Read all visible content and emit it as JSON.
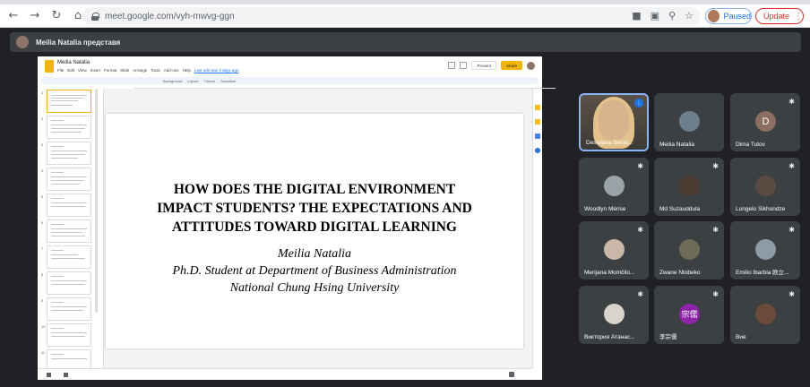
{
  "browser": {
    "url": "meet.google.com/vyh-mwvg-ggn",
    "profile_status": "Paused",
    "update_label": "Update",
    "nav_icons": [
      "back-arrow",
      "forward-arrow",
      "reload",
      "home"
    ]
  },
  "meet": {
    "presenting_label": "Meilia Natalia представя"
  },
  "slides_app": {
    "doc_title": "Meilia Natalia",
    "menus": [
      "File",
      "Edit",
      "View",
      "Insert",
      "Format",
      "Slide",
      "Arrange",
      "Tools",
      "Add-ons",
      "Help",
      "Last edit was 2 days ago"
    ],
    "present_label": "Present",
    "share_label": "Share",
    "toolbar_items": [
      "Background",
      "Layout",
      "Theme",
      "Transition"
    ],
    "thumb_numbers": [
      "1",
      "2",
      "3",
      "4",
      "5",
      "6",
      "7",
      "8",
      "9",
      "10",
      "11"
    ]
  },
  "slide": {
    "title_line1": "HOW DOES THE DIGITAL ENVIRONMENT",
    "title_line2": "IMPACT STUDENTS? THE EXPECTATIONS AND",
    "title_line3": "ATTITUDES TOWARD DIGITAL LEARNING",
    "author": "Meilia Natalia",
    "affiliation": "Ph.D. Student at Department of Business Administration",
    "university": "National Chung Hsing University"
  },
  "participants": [
    {
      "name": "Desislava Serafi...",
      "speaking": true
    },
    {
      "name": "Meilia Natalia",
      "avatar": "photo",
      "color": "#6b7f8c"
    },
    {
      "name": "Dima Tutov",
      "avatar": "letter",
      "letter": "D",
      "color": "#8d6e63"
    },
    {
      "name": "Woodlyn Mérise",
      "avatar": "photo",
      "color": "#9aa4a8"
    },
    {
      "name": "Md Suzauddula",
      "avatar": "photo",
      "color": "#4a3a30"
    },
    {
      "name": "Lungelo Sikhondze",
      "avatar": "photo",
      "color": "#5a4a42"
    },
    {
      "name": "Merijana Momčilo...",
      "avatar": "photo",
      "color": "#c9b8a8"
    },
    {
      "name": "Zwane Ntobeko",
      "avatar": "photo",
      "color": "#6d6a55"
    },
    {
      "name": "Emilio Ibarbia 欧立...",
      "avatar": "photo",
      "color": "#8e9aa8"
    },
    {
      "name": "Виктория Атанас...",
      "avatar": "photo",
      "color": "#d8d4cc"
    },
    {
      "name": "李宗儒",
      "avatar": "letter",
      "letter": "宗儒",
      "color": "#8e24aa"
    },
    {
      "name": "Вие",
      "avatar": "photo",
      "color": "#6b4a3a"
    }
  ],
  "colors": {
    "meet_bg": "#202124",
    "tile_bg": "#3c4043",
    "speaking_border": "#8ab4f8",
    "slides_accent": "#f4b400",
    "update_red": "#d93025"
  }
}
